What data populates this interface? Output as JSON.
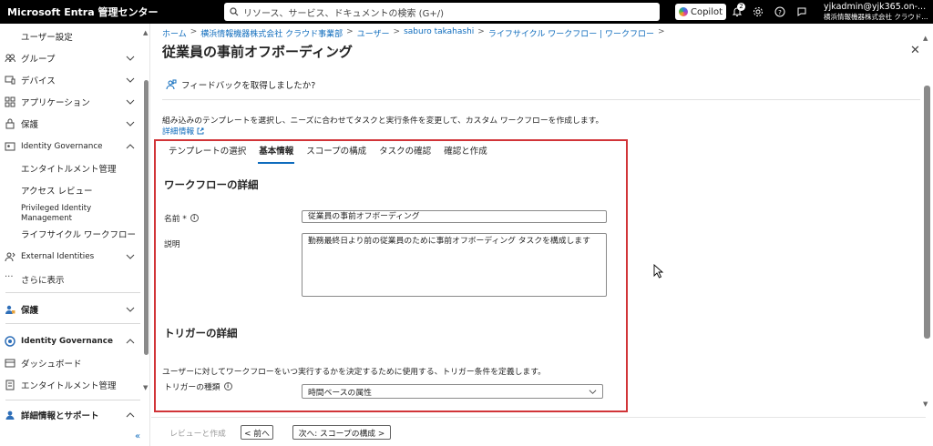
{
  "topbar": {
    "brand": "Microsoft Entra 管理センター",
    "search_placeholder": "リソース、サービス、ドキュメントの検索 (G+/)",
    "copilot_label": "Copilot",
    "notifications_count": "2",
    "account_user": "yjkadmin@yjk365.on-...",
    "account_tenant": "横浜情報機器株式会社 クラウド..."
  },
  "sidebar": {
    "items": [
      {
        "label": "ユーザー設定"
      },
      {
        "label": "グループ"
      },
      {
        "label": "デバイス"
      },
      {
        "label": "アプリケーション"
      },
      {
        "label": "保護"
      },
      {
        "label": "Identity Governance"
      },
      {
        "label": "エンタイトルメント管理"
      },
      {
        "label": "アクセス レビュー"
      },
      {
        "label": "Privileged Identity Management"
      },
      {
        "label": "ライフサイクル ワークフロー"
      },
      {
        "label": "External Identities"
      },
      {
        "label": "さらに表示"
      },
      {
        "label": "保護"
      },
      {
        "label": "Identity Governance"
      },
      {
        "label": "ダッシュボード"
      },
      {
        "label": "エンタイトルメント管理"
      },
      {
        "label": "詳細情報とサポート"
      }
    ]
  },
  "breadcrumb": [
    "ホーム",
    "横浜情報機器株式会社 クラウド事業部",
    "ユーザー",
    "saburo takahashi",
    "ライフサイクル ワークフロー | ワークフロー"
  ],
  "page": {
    "title": "従業員の事前オフボーディング",
    "feedback": "フィードバックを取得しましたか?",
    "intro": "組み込みのテンプレートを選択し、ニーズに合わせてタスクと実行条件を変更して、カスタム ワークフローを作成します。",
    "learn_more": "詳細情報"
  },
  "tabs": [
    "テンプレートの選択",
    "基本情報",
    "スコープの構成",
    "タスクの確認",
    "確認と作成"
  ],
  "form": {
    "section1": "ワークフローの詳細",
    "name_label": "名前 *",
    "name_value": "従業員の事前オフボーディング",
    "desc_label": "説明",
    "desc_value": "勤務最終日より前の従業員のために事前オフボーディング タスクを構成します",
    "section2": "トリガーの詳細",
    "trigger_help": "ユーザーに対してワークフローをいつ実行するかを決定するために使用する、トリガー条件を定義します。",
    "trigger_label": "トリガーの種類",
    "trigger_value": "時間ベースの属性"
  },
  "footer": {
    "review_label": "レビューと作成",
    "prev_label": "< 前へ",
    "next_label": "次へ: スコープの構成 >"
  },
  "colors": {
    "accent": "#0f6cbd",
    "highlight_box": "#d13438"
  }
}
